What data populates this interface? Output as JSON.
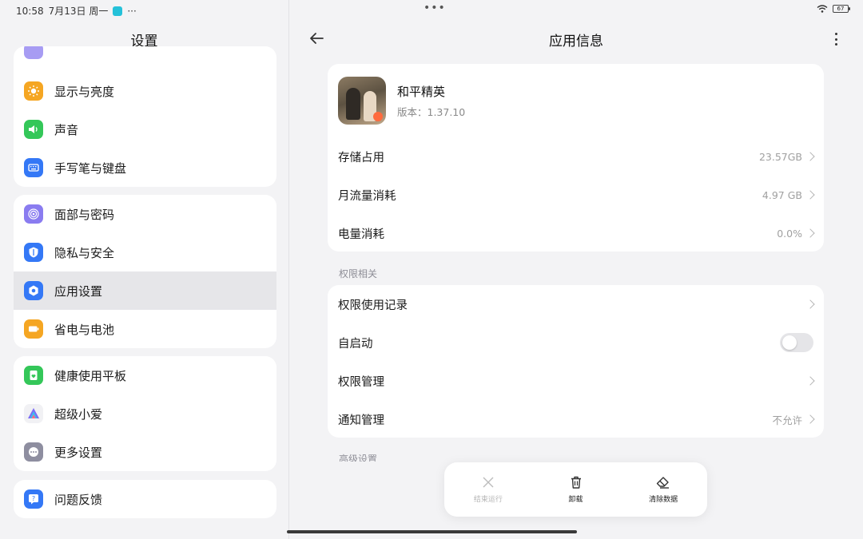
{
  "status_bar": {
    "time": "10:58",
    "date": "7月13日 周一",
    "more_dots": "···",
    "center_dots": "•••",
    "battery": "67"
  },
  "left": {
    "title": "设置",
    "group1": [
      {
        "label": "显示与亮度",
        "icon": "sun-icon",
        "color": "#f5a623"
      },
      {
        "label": "声音",
        "icon": "speaker-icon",
        "color": "#34c759"
      },
      {
        "label": "手写笔与键盘",
        "icon": "keyboard-icon",
        "color": "#3478f6"
      }
    ],
    "group2": [
      {
        "label": "面部与密码",
        "icon": "fingerprint-icon",
        "color": "#8a7cf0"
      },
      {
        "label": "隐私与安全",
        "icon": "shield-icon",
        "color": "#3478f6"
      },
      {
        "label": "应用设置",
        "icon": "app-settings-icon",
        "color": "#3478f6",
        "active": true
      },
      {
        "label": "省电与电池",
        "icon": "battery-icon",
        "color": "#f5a623"
      }
    ],
    "group3": [
      {
        "label": "健康使用平板",
        "icon": "health-icon",
        "color": "#34c759"
      },
      {
        "label": "超级小爱",
        "icon": "xiaoai-icon",
        "color": "#ffffff"
      },
      {
        "label": "更多设置",
        "icon": "more-settings-icon",
        "color": "#8e8ea0"
      }
    ],
    "group4": [
      {
        "label": "问题反馈",
        "icon": "feedback-icon",
        "color": "#3478f6"
      }
    ]
  },
  "right": {
    "title": "应用信息",
    "app": {
      "name": "和平精英",
      "version": "版本：1.37.10"
    },
    "usage": [
      {
        "label": "存储占用",
        "value": "23.57GB"
      },
      {
        "label": "月流量消耗",
        "value": "4.97 GB"
      },
      {
        "label": "电量消耗",
        "value": "0.0%"
      }
    ],
    "permissions_section": "权限相关",
    "permissions": {
      "records": "权限使用记录",
      "autostart": "自启动",
      "autostart_on": false,
      "manage": "权限管理",
      "notify": "通知管理",
      "notify_value": "不允许"
    },
    "advanced_section": "高级设置"
  },
  "actions": [
    {
      "label": "结束运行",
      "icon": "close-icon",
      "enabled": false
    },
    {
      "label": "卸载",
      "icon": "trash-icon",
      "enabled": true
    },
    {
      "label": "清除数据",
      "icon": "eraser-icon",
      "enabled": true
    }
  ]
}
